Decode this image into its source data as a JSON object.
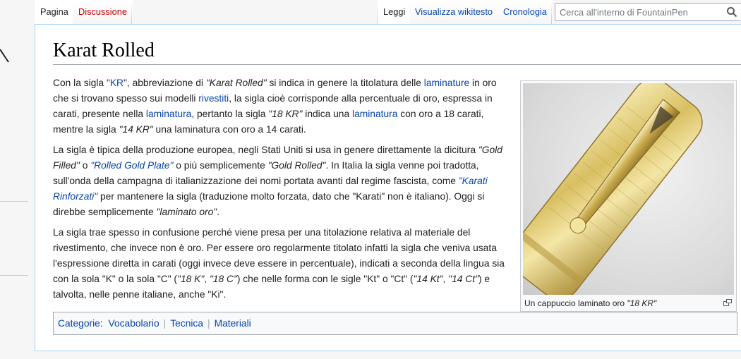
{
  "tabs": {
    "page": "Pagina",
    "discussion": "Discussione",
    "read": "Leggi",
    "view_source": "Visualizza wikitesto",
    "history": "Cronologia"
  },
  "search": {
    "placeholder": "Cerca all'interno di FountainPen"
  },
  "page_title": "Karat Rolled",
  "paragraphs": {
    "p1": {
      "t1": "Con la sigla \"",
      "l1": "KR",
      "t2": "\", abbreviazione di ",
      "i1": "\"Karat Rolled\"",
      "t3": " si indica in genere la titolatura delle ",
      "l2": "laminature",
      "t4": " in oro che si trovano spesso sui modelli ",
      "l3": "rivestiti",
      "t5": ", la sigla cioè corrisponde alla percentuale di oro, espressa in carati, presente nella ",
      "l4": "laminatura",
      "t6": ", pertanto la sigla ",
      "i2": "\"18 KR\"",
      "t7": " indica una ",
      "l5": "laminatura",
      "t8": " con oro a 18 carati, mentre la sigla ",
      "i3": "\"14 KR\"",
      "t9": " una laminatura con oro a 14 carati."
    },
    "p2": {
      "t1": "La sigla è tipica della produzione europea, negli Stati Uniti si usa in genere direttamente la dicitura ",
      "i1": "\"Gold Filled\"",
      "t2": " o ",
      "i2": "\"Rolled Gold Plate\"",
      "t3": " o più semplicemente ",
      "i3": "\"Gold Rolled\"",
      "t4": ". In Italia la sigla venne poi tradotta, sull'onda della campagna di italianizzazione dei nomi portata avanti dal regime fascista, come ",
      "i4": "\"Karati Rinforzati\"",
      "t5": " per mantenere la sigla (traduzione molto forzata, dato che \"Karati\" non è italiano). Oggi si direbbe semplicemente ",
      "i5": "\"laminato oro\"",
      "t6": "."
    },
    "p3": {
      "t1": "La sigla trae spesso in confusione perché viene presa per una titolazione relativa al materiale del rivestimento, che invece non è oro. Per essere oro regolarmente titolato infatti la sigla che veniva usata l'espressione diretta in carati (oggi invece deve essere in percentuale), indicati a seconda della lingua sia con la sola \"K\" o la sola \"C\" (",
      "i1": "\"18 K\"",
      "t2": ", ",
      "i2": "\"18 C\"",
      "t3": ") che nelle forma con le sigle \"Kt\" o \"Ct\" (",
      "i3": "\"14 Kt\"",
      "t4": ", ",
      "i4": "\"14 Ct\"",
      "t5": ") e talvolta, nelle penne italiane, anche \"Ki\"."
    }
  },
  "thumbnail": {
    "caption_text": "Un cappuccio laminato oro ",
    "caption_italic": "\"18 KR\""
  },
  "categories": {
    "label": "Categorie",
    "colon": ":",
    "items": [
      "Vocabolario",
      "Tecnica",
      "Materiali"
    ]
  },
  "colors": {
    "link": "#0645ad",
    "redlink": "#ba0000",
    "tab_border": "#a7d7f9",
    "gold": "#d9c36a"
  },
  "icons": {
    "search": "magnifier",
    "enlarge": "magnify-clip"
  }
}
